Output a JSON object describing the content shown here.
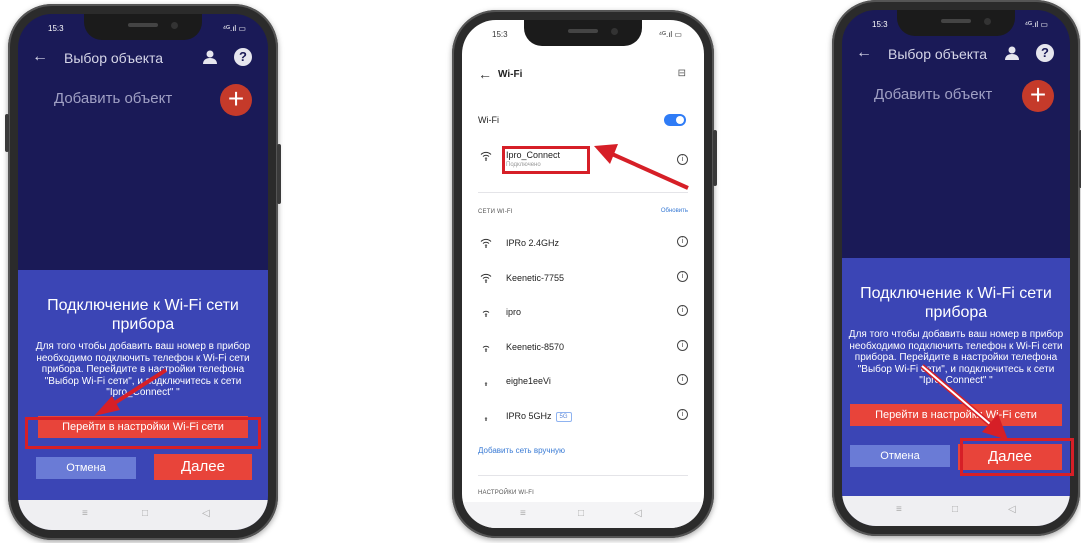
{
  "status": {
    "time": "15:3",
    "icons": "⁴ᴳ.ıl ▭"
  },
  "app": {
    "title": "Выбор объекта",
    "add_label": "Добавить объект",
    "add_symbol": "+",
    "help_symbol": "?",
    "back_symbol": "←"
  },
  "dialog": {
    "title": "Подключение к Wi-Fi сети прибора",
    "text": "Для того чтобы добавить ваш номер в прибор необходимо подключить телефон к Wi-Fi сети прибора. Перейдите в настройки телефона \"Выбор Wi-Fi сети\", и подключитесь к сети \"Ipro_Connect\"  \"",
    "wifi_button": "Перейти в настройки Wi-Fi сети",
    "cancel_button": "Отмена",
    "next_button": "Далее"
  },
  "nav": {
    "menu": "≡",
    "home": "□",
    "back": "◁"
  },
  "settings": {
    "back_symbol": "←",
    "title": "Wi-Fi",
    "menu_symbol": "⊟",
    "wifi_toggle_label": "Wi-Fi",
    "wifi_enabled": true,
    "connected": {
      "name": "Ipro_Connect",
      "status": "Подключено"
    },
    "section_networks": "СЕТИ WI-FI",
    "refresh": "Обновить",
    "networks": [
      {
        "name": "IPRo 2.4GHz",
        "badge": ""
      },
      {
        "name": "Keenetic-7755",
        "badge": ""
      },
      {
        "name": "ipro",
        "badge": ""
      },
      {
        "name": "Keenetic-8570",
        "badge": ""
      },
      {
        "name": "eighe1eeVi",
        "badge": ""
      },
      {
        "name": "IPRo 5GHz",
        "badge": "5G"
      }
    ],
    "add_manual": "Добавить сеть вручную",
    "section_settings": "НАСТРОЙКИ WI-FI",
    "info_symbol": "i"
  },
  "colors": {
    "highlight": "#d61f27",
    "app_bg": "#1a1a57",
    "dialog_bg": "#3b45b5",
    "accent_red": "#e8443a",
    "cancel_blue": "#6a7bd6",
    "toggle_blue": "#2f7cf6"
  },
  "icons": [
    "back-arrow-icon",
    "user-icon",
    "help-icon",
    "plus-icon",
    "wifi-icon",
    "info-icon",
    "menu-icon",
    "home-icon",
    "back-icon",
    "highlight-arrow-icon"
  ]
}
